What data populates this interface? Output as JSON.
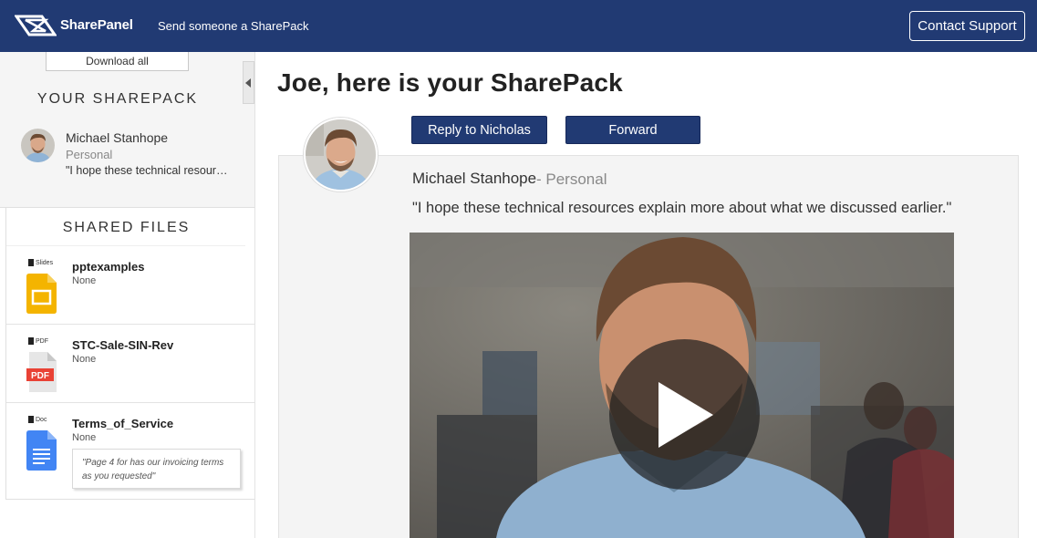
{
  "header": {
    "brand": "SharePanel",
    "send_link": "Send someone a SharePack",
    "contact_label": "Contact Support"
  },
  "sidebar": {
    "download_label": "Download all",
    "sharepack_title": "YOUR SHAREPACK",
    "sender": {
      "name": "Michael Stanhope",
      "type": "Personal",
      "message_preview": "\"I hope these technical resources explain more about what we discussed earlier.\""
    },
    "files_title": "SHARED FILES",
    "files": [
      {
        "type_label": "Slides",
        "name": "pptexamples",
        "sub": "None",
        "icon": "slides-icon",
        "color": "#f4b400"
      },
      {
        "type_label": "PDF",
        "name": "STC-Sale-SIN-Rev",
        "sub": "None",
        "icon": "pdf-icon",
        "color": "#e94235"
      },
      {
        "type_label": "Doc",
        "name": "Terms_of_Service",
        "sub": "None",
        "icon": "doc-icon",
        "color": "#4285f4",
        "note": "\"Page 4 for has our invoicing terms as you requested\""
      }
    ]
  },
  "main": {
    "title": "Joe, here is your SharePack",
    "reply_label": "Reply to Nicholas",
    "forward_label": "Forward",
    "sender_name": "Michael Stanhope",
    "sender_type": "- Personal",
    "message": "\"I hope these technical resources explain more about what we discussed earlier.\""
  },
  "colors": {
    "header_bg": "#213a73",
    "button_bg": "#213a73",
    "card_bg": "#f4f4f4"
  }
}
